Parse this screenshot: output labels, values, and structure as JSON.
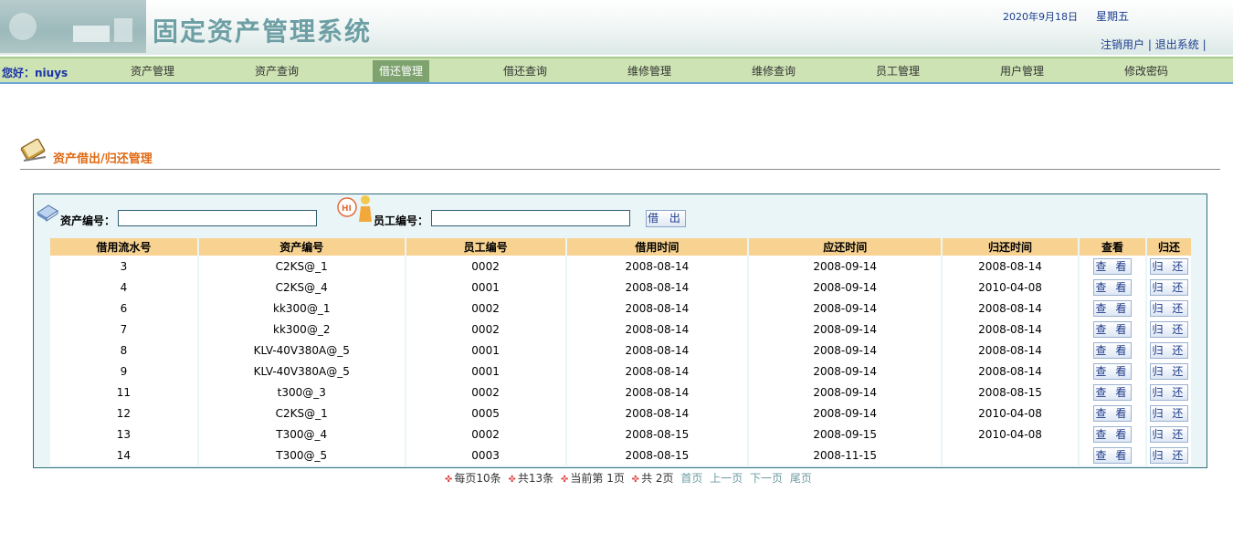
{
  "header": {
    "title": "固定资产管理系统",
    "date": "2020年9月18日",
    "weekday": "星期五",
    "logout_link": "注销用户",
    "exit_link": "退出系统",
    "separator": "|"
  },
  "nav": {
    "greeting": "您好：niuys",
    "items": [
      {
        "label": "资产管理"
      },
      {
        "label": "资产查询"
      },
      {
        "label": "借还管理",
        "active": true
      },
      {
        "label": "借还查询"
      },
      {
        "label": "维修管理"
      },
      {
        "label": "维修查询"
      },
      {
        "label": "员工管理"
      },
      {
        "label": "用户管理"
      },
      {
        "label": "修改密码"
      }
    ]
  },
  "section": {
    "title": "资产借出/归还管理",
    "icon": "notebook-pencil-icon"
  },
  "search": {
    "asset_label": "资产编号：",
    "asset_value": "",
    "employee_label": "员工编号：",
    "employee_value": "",
    "lend_button": "借 出",
    "asset_icon": "book-icon",
    "employee_icon": "hi-person-icon"
  },
  "table": {
    "columns": [
      "借用流水号",
      "资产编号",
      "员工编号",
      "借用时间",
      "应还时间",
      "归还时间",
      "查看",
      "归还"
    ],
    "view_label": "查 看",
    "return_label": "归 还",
    "rows": [
      {
        "id": "3",
        "asset": "C2KS@_1",
        "employee": "0002",
        "borrowed": "2008-08-14",
        "due": "2008-09-14",
        "returned": "2008-08-14"
      },
      {
        "id": "4",
        "asset": "C2KS@_4",
        "employee": "0001",
        "borrowed": "2008-08-14",
        "due": "2008-09-14",
        "returned": "2010-04-08"
      },
      {
        "id": "6",
        "asset": "kk300@_1",
        "employee": "0002",
        "borrowed": "2008-08-14",
        "due": "2008-09-14",
        "returned": "2008-08-14"
      },
      {
        "id": "7",
        "asset": "kk300@_2",
        "employee": "0002",
        "borrowed": "2008-08-14",
        "due": "2008-09-14",
        "returned": "2008-08-14"
      },
      {
        "id": "8",
        "asset": "KLV-40V380A@_5",
        "employee": "0001",
        "borrowed": "2008-08-14",
        "due": "2008-09-14",
        "returned": "2008-08-14"
      },
      {
        "id": "9",
        "asset": "KLV-40V380A@_5",
        "employee": "0001",
        "borrowed": "2008-08-14",
        "due": "2008-09-14",
        "returned": "2008-08-14"
      },
      {
        "id": "11",
        "asset": "t300@_3",
        "employee": "0002",
        "borrowed": "2008-08-14",
        "due": "2008-09-14",
        "returned": "2008-08-15"
      },
      {
        "id": "12",
        "asset": "C2KS@_1",
        "employee": "0005",
        "borrowed": "2008-08-14",
        "due": "2008-09-14",
        "returned": "2010-04-08"
      },
      {
        "id": "13",
        "asset": "T300@_4",
        "employee": "0002",
        "borrowed": "2008-08-15",
        "due": "2008-09-15",
        "returned": "2010-04-08"
      },
      {
        "id": "14",
        "asset": "T300@_5",
        "employee": "0003",
        "borrowed": "2008-08-15",
        "due": "2008-11-15",
        "returned": ""
      }
    ]
  },
  "pager": {
    "per_page": "每页10条",
    "total": "共13条",
    "current": "当前第 1页",
    "pages": "共 2页",
    "first": "首页",
    "prev": "上一页",
    "next": "下一页",
    "last": "尾页"
  }
}
